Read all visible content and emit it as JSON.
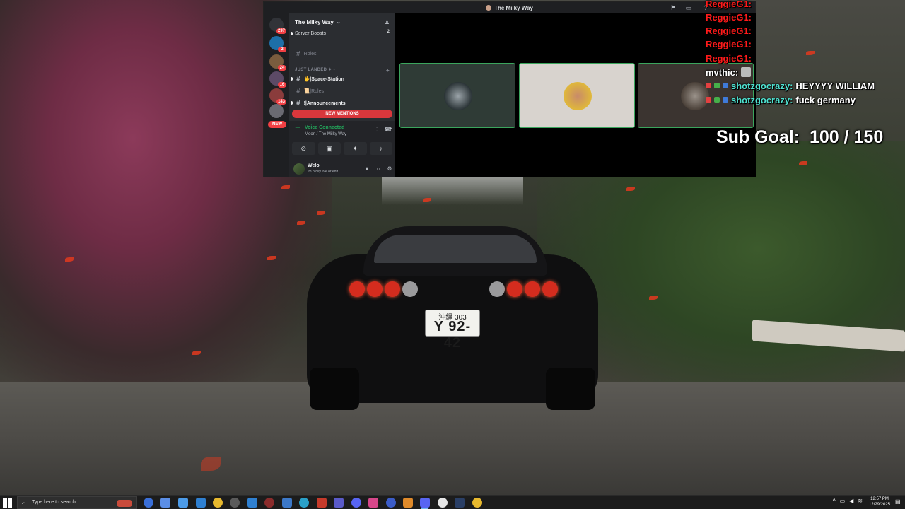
{
  "window": {
    "title": "The Milky Way"
  },
  "guild_badges": [
    "297",
    "2",
    "24",
    "16",
    "143"
  ],
  "guild_new_label": "NEW",
  "server": {
    "name": "The Milky Way",
    "boosts_label": "Server Boosts",
    "boosts_count": "2"
  },
  "channels": {
    "roles_top": "Roles",
    "category": "JUST LANDED ✦ -",
    "space_station": "🖖|Space-Station",
    "rules": "📜|Rules",
    "announcements": "!|Announcements",
    "new_mentions": "NEW MENTIONS"
  },
  "voice": {
    "status": "Voice Connected",
    "location": "Moon / The Milky Way"
  },
  "user": {
    "name": "Welo",
    "status": "Im prolly live or edit..."
  },
  "chat": [
    {
      "user": "ReggieG1:",
      "color": "red",
      "message": ""
    },
    {
      "user": "ReggieG1:",
      "color": "red",
      "message": ""
    },
    {
      "user": "ReggieG1:",
      "color": "red",
      "message": ""
    },
    {
      "user": "ReggieG1:",
      "color": "red",
      "message": ""
    },
    {
      "user": "ReggieG1:",
      "color": "red",
      "message": ""
    },
    {
      "user": "mvthic:",
      "color": "white",
      "message": ""
    },
    {
      "user": "shotzgocrazy:",
      "color": "teal",
      "message": "HEYYYY WILLIAM"
    },
    {
      "user": "shotzgocrazy:",
      "color": "teal",
      "message": "fuck germany"
    }
  ],
  "sub_goal": {
    "label": "Sub Goal:",
    "value": "100 / 150"
  },
  "plate": {
    "line1": "沖縄 303",
    "line2": "Y 92-42"
  },
  "taskbar": {
    "search_placeholder": "Type here to search",
    "time": "12:57 PM",
    "date": "12/29/2025"
  },
  "colors": {
    "discord_green": "#23a55a",
    "mention_red": "#da373c",
    "chat_red": "#ff1a1a",
    "chat_teal": "#4fe3d2"
  }
}
